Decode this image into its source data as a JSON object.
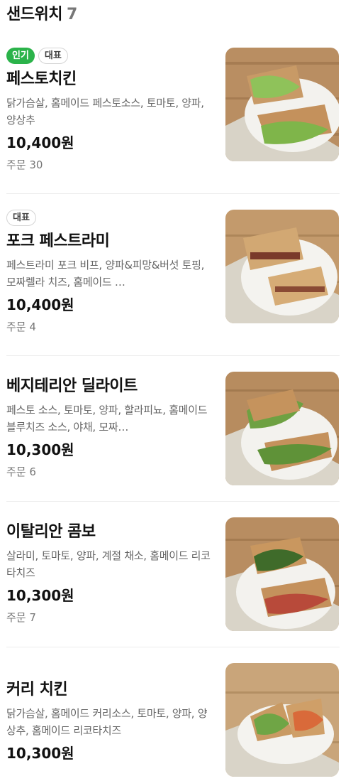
{
  "category": {
    "title": "샌드위치",
    "count": "7"
  },
  "items": [
    {
      "badges": [
        "인기",
        "대표"
      ],
      "name": "페스토치킨",
      "desc": "닭가슴살, 홈메이드 페스토소스, 토마토, 양파, 양상추",
      "price": "10,400원",
      "orders": "주문 30"
    },
    {
      "badges": [
        "대표"
      ],
      "name": "포크 페스트라미",
      "desc": "페스트라미 포크 비프, 양파&피망&버섯 토핑, 모짜렐라 치즈, 홈메이드 …",
      "price": "10,400원",
      "orders": "주문 4"
    },
    {
      "name": "베지테리안 딜라이트",
      "desc": "페스토 소스, 토마토, 양파, 할라피뇨, 홈메이드 블루치즈 소스, 야채, 모짜…",
      "price": "10,300원",
      "orders": "주문 6"
    },
    {
      "name": "이탈리안 콤보",
      "desc": "살라미, 토마토, 양파, 계절 채소, 홈메이드 리코타치즈",
      "price": "10,300원",
      "orders": "주문 7"
    },
    {
      "name": "커리 치킨",
      "desc": "닭가슴살, 홈메이드 커리소스, 토마토, 양파, 양상추, 홈메이드 리코타치즈",
      "price": "10,300원"
    }
  ]
}
